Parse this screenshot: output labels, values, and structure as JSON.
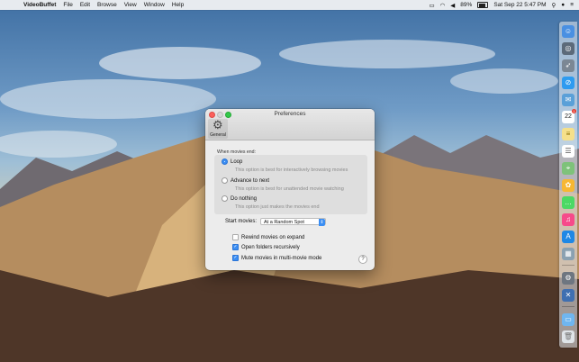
{
  "menubar": {
    "apple_glyph": "",
    "app_name": "VideoBuffet",
    "menus": [
      "File",
      "Edit",
      "Browse",
      "View",
      "Window",
      "Help"
    ],
    "battery_percent": "89%",
    "battery_level": 0.89,
    "datetime": "Sat Sep 22  5:47 PM",
    "status_icons": [
      "airplay-icon",
      "wifi-icon",
      "volume-icon",
      "battery-icon",
      "spotlight-icon",
      "user-icon",
      "notification-center-icon"
    ]
  },
  "window": {
    "title": "Preferences",
    "toolbar": {
      "general_label": "General"
    },
    "when_label": "When movies end:",
    "options": [
      {
        "label": "Loop",
        "hint": "This option is best for interactively browsing movies",
        "selected": true
      },
      {
        "label": "Advance to next",
        "hint": "This option is best for unattended movie watching",
        "selected": false
      },
      {
        "label": "Do nothing",
        "hint": "This option just makes the movies end",
        "selected": false
      }
    ],
    "start_label": "Start movies:",
    "start_value": "At a Random Spot",
    "checks": [
      {
        "label": "Rewind movies on expand",
        "checked": false
      },
      {
        "label": "Open folders recursively",
        "checked": true
      },
      {
        "label": "Mute movies in multi-movie mode",
        "checked": true
      }
    ],
    "help_glyph": "?"
  },
  "dock": {
    "calendar_day": "22",
    "mail_badge": "1",
    "icons": [
      "finder-icon",
      "launchpad-icon",
      "rocket-icon",
      "safari-icon",
      "mail-icon",
      "calendar-icon",
      "notes-icon",
      "reminders-icon",
      "maps-icon",
      "photos-icon",
      "messages-icon",
      "itunes-icon",
      "app-store-icon",
      "preview-icon",
      "system-preferences-icon",
      "xcode-icon",
      "downloads-folder-icon",
      "trash-icon"
    ]
  },
  "colors": {
    "accent": "#3b8ef3",
    "window_bg": "#ececec"
  }
}
